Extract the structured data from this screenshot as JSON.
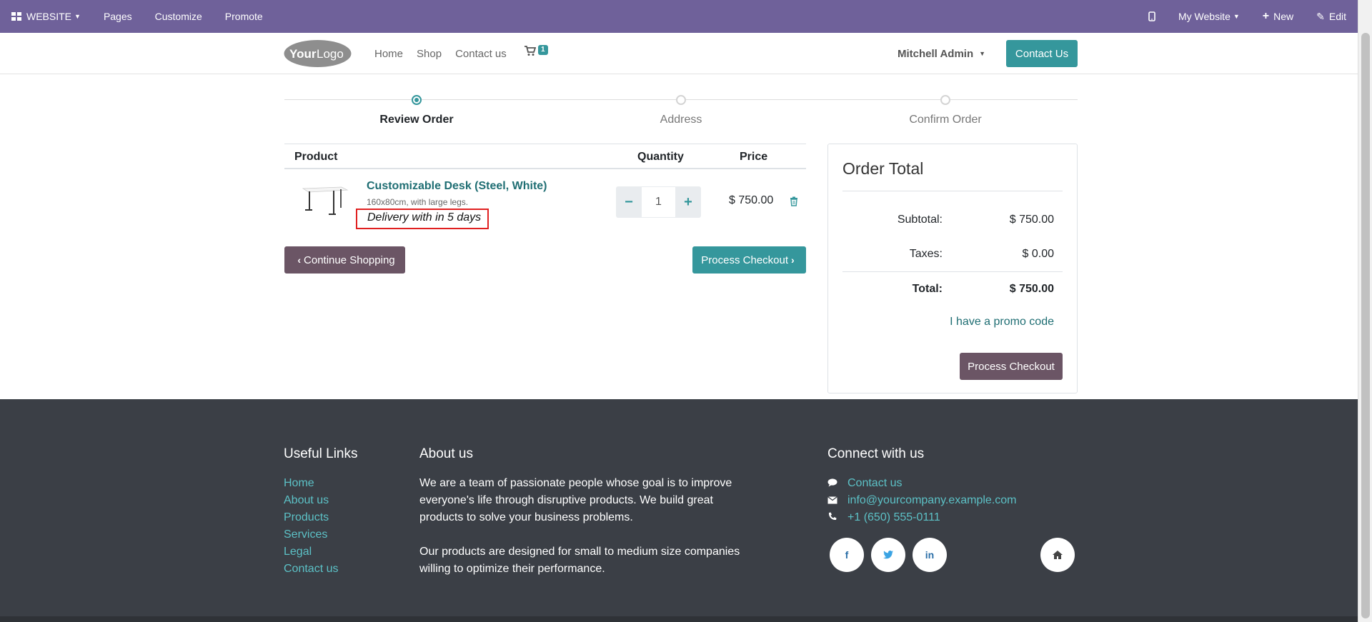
{
  "admin_bar": {
    "website_label": "WEBSITE",
    "pages_label": "Pages",
    "customize_label": "Customize",
    "promote_label": "Promote",
    "my_website_label": "My Website",
    "new_label": "New",
    "edit_label": "Edit"
  },
  "header": {
    "logo_text_bold": "Your",
    "logo_text": "Logo",
    "nav": [
      "Home",
      "Shop",
      "Contact us"
    ],
    "cart_count": "1",
    "user_name": "Mitchell Admin",
    "contact_button": "Contact Us"
  },
  "wizard": {
    "steps": [
      "Review Order",
      "Address",
      "Confirm Order"
    ],
    "active_step": 0
  },
  "cart": {
    "columns": {
      "product": "Product",
      "quantity": "Quantity",
      "price": "Price"
    },
    "items": [
      {
        "name": "Customizable Desk (Steel, White)",
        "description": "160x80cm, with large legs.",
        "delivery": "Delivery with in 5 days",
        "quantity": "1",
        "price": "$ 750.00"
      }
    ],
    "continue_label": "Continue Shopping",
    "checkout_label": "Process Checkout"
  },
  "order_total": {
    "title": "Order Total",
    "subtotal_label": "Subtotal:",
    "subtotal_value": "$ 750.00",
    "taxes_label": "Taxes:",
    "taxes_value": "$ 0.00",
    "total_label": "Total:",
    "total_value": "$ 750.00",
    "promo_label": "I have a promo code",
    "checkout_label": "Process Checkout"
  },
  "footer": {
    "useful_links_title": "Useful Links",
    "useful_links": [
      "Home",
      "About us",
      "Products",
      "Services",
      "Legal",
      "Contact us"
    ],
    "about_title": "About us",
    "about_p1": "We are a team of passionate people whose goal is to improve everyone's life through disruptive products. We build great products to solve your business problems.",
    "about_p2": "Our products are designed for small to medium size companies willing to optimize their performance.",
    "connect_title": "Connect with us",
    "contact_link": "Contact us",
    "email": "info@yourcompany.example.com",
    "phone": "+1 (650) 555-0111",
    "social": [
      "facebook-icon",
      "twitter-icon",
      "linkedin-icon",
      "home-icon"
    ]
  },
  "colors": {
    "admin_bar": "#6f619a",
    "primary": "#35979c",
    "secondary": "#6b5565",
    "footer_bg": "#3b3f46",
    "footer_link": "#5cc1c6"
  }
}
